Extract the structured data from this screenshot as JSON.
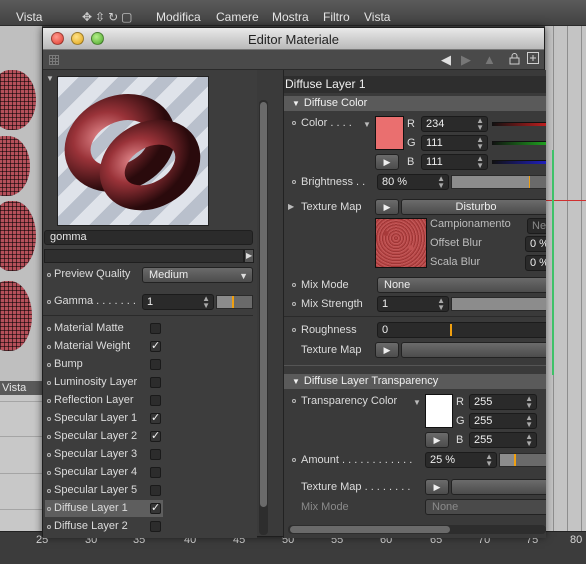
{
  "host": {
    "top_vista": "Vista",
    "menu": [
      "Modifica",
      "Camere",
      "Mostra",
      "Filtro",
      "Vista"
    ],
    "bottom_vista": "Vista",
    "ruler": [
      "25",
      "30",
      "35",
      "40",
      "45",
      "50",
      "55",
      "60",
      "65",
      "70",
      "75",
      "80"
    ]
  },
  "window": {
    "title": "Editor Materiale",
    "toolbar_icons": [
      "arrow-left-icon",
      "arrow-right-icon",
      "arrow-up-icon",
      "lock-icon",
      "new-window-icon"
    ]
  },
  "left": {
    "material_name": "gomma",
    "preview_quality": {
      "label": "Preview Quality",
      "value": "Medium"
    },
    "gamma": {
      "label": "Gamma",
      "value": "1",
      "slider_fraction": 0.45
    },
    "channels": [
      {
        "label": "Material Matte",
        "checked": false
      },
      {
        "label": "Material Weight",
        "checked": true
      },
      {
        "label": "Bump",
        "checked": false
      },
      {
        "label": "Luminosity Layer",
        "checked": false
      },
      {
        "label": "Reflection Layer",
        "checked": false
      },
      {
        "label": "Specular Layer 1",
        "checked": true
      },
      {
        "label": "Specular Layer 2",
        "checked": true
      },
      {
        "label": "Specular Layer 3",
        "checked": false
      },
      {
        "label": "Specular Layer 4",
        "checked": false
      },
      {
        "label": "Specular Layer 5",
        "checked": false
      },
      {
        "label": "Diffuse Layer 1",
        "checked": true,
        "selected": true
      },
      {
        "label": "Diffuse Layer 2",
        "checked": false
      }
    ]
  },
  "right": {
    "panel_title": "Diffuse Layer 1",
    "diffuse_color": {
      "section": "Diffuse Color",
      "color_label": "Color",
      "swatch": "#EA6F6F",
      "r_label": "R",
      "r": "234",
      "g_label": "G",
      "g": "111",
      "b_label": "B",
      "b": "111",
      "brightness_label": "Brightness",
      "brightness": "80 %",
      "brightness_fraction": 0.8,
      "texture_map_label": "Texture Map",
      "texture_name": "Disturbo",
      "sampling_label": "Campionamento",
      "sampling_value": "Nes",
      "offset_blur_label": "Offset Blur",
      "offset_blur": "0 %",
      "scale_blur_label": "Scala Blur",
      "scale_blur": "0 %",
      "mix_mode_label": "Mix Mode",
      "mix_mode": "None",
      "mix_strength_label": "Mix Strength",
      "mix_strength": "1",
      "roughness_label": "Roughness",
      "roughness": "0",
      "roughness_texture_label": "Texture Map"
    },
    "transparency": {
      "section": "Diffuse Layer Transparency",
      "color_label": "Transparency Color",
      "swatch": "#FFFFFF",
      "r_label": "R",
      "r": "255",
      "g_label": "G",
      "g": "255",
      "b_label": "B",
      "b": "255",
      "amount_label": "Amount",
      "amount": "25 %",
      "amount_fraction": 0.25,
      "texture_map_label": "Texture Map",
      "mix_mode_label": "Mix Mode",
      "mix_mode": "None"
    }
  },
  "colors": {
    "selection": "#5E5E5E",
    "accent_orange": "#F0A010",
    "red_channel": "#D02020",
    "green_channel": "#20B020",
    "blue_channel": "#2020D0"
  }
}
